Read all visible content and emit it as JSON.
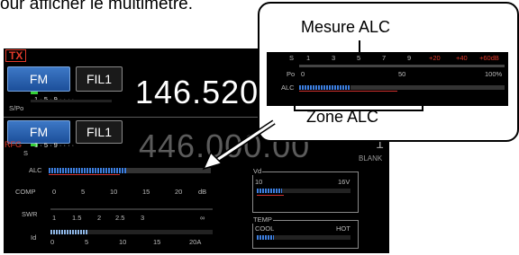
{
  "intro_text": "our afficher le multimètre.",
  "top_band": {
    "tx_label": "TX",
    "mode_button": "FM",
    "filter_button": "FIL1",
    "meter_label": "S/Po",
    "meter_scale": "1 · 5 · 9 · · · ·",
    "frequency": "146.520"
  },
  "bottom_band": {
    "rfg_label": "RFG",
    "mode_button": "FM",
    "filter_button": "FIL1",
    "meter_label": "S",
    "meter_scale": "1 · 5 · 9 · · · ·",
    "frequency": "446.000.00",
    "memory_channel": "1",
    "memory_name": "BLANK"
  },
  "meters": {
    "alc_label": "ALC",
    "comp_label": "COMP",
    "comp_scale": [
      "0",
      "5",
      "10",
      "15",
      "20",
      "dB"
    ],
    "swr_label": "SWR",
    "swr_scale": [
      "1",
      "1.5",
      "2",
      "2.5",
      "3",
      "∞"
    ],
    "id_label": "Id",
    "id_scale": [
      "0",
      "5",
      "10",
      "15",
      "20A"
    ],
    "alc_level": 0.48
  },
  "vd_panel": {
    "label": "Vd",
    "min": "10",
    "max": "16V",
    "level": 0.27
  },
  "temp_panel": {
    "label": "TEMP",
    "cool": "COOL",
    "hot": "HOT",
    "level": 0.18
  },
  "callout": {
    "title": "Mesure ALC",
    "zone_label": "Zone ALC",
    "s_label": "S",
    "s_scale": [
      "1",
      "3",
      "5",
      "7",
      "9",
      "+20",
      "+40",
      "+60dB"
    ],
    "po_label": "Po",
    "po_scale": [
      "0",
      "50",
      "100%"
    ],
    "alc_label": "ALC"
  },
  "colors": {
    "accent_blue": "#3d78c6",
    "meter_red": "#d0312d",
    "tx_red": "#e23a2a"
  }
}
